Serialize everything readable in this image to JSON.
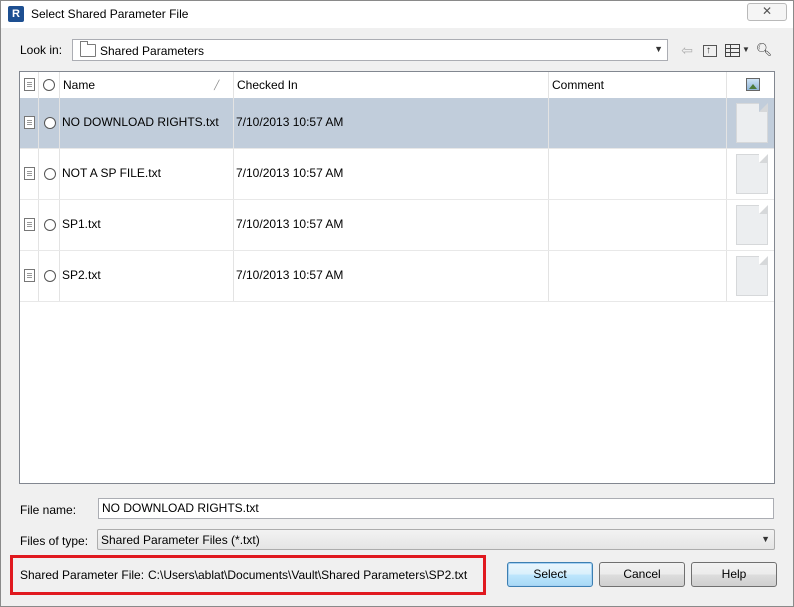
{
  "window": {
    "title": "Select Shared Parameter File",
    "close_glyph": "✕"
  },
  "lookin": {
    "label": "Look in:",
    "value": "Shared Parameters"
  },
  "toolbar": {
    "icons": [
      "back-arrow-icon",
      "up-one-level-icon",
      "views-menu-icon",
      "find-files-icon"
    ]
  },
  "columns": {
    "name": "Name",
    "checked_in": "Checked In",
    "comment": "Comment"
  },
  "files": [
    {
      "name": "NO DOWNLOAD RIGHTS.txt",
      "checked_in": "7/10/2013 10:57 AM",
      "comment": "",
      "selected": true
    },
    {
      "name": "NOT A SP FILE.txt",
      "checked_in": "7/10/2013 10:57 AM",
      "comment": "",
      "selected": false
    },
    {
      "name": "SP1.txt",
      "checked_in": "7/10/2013 10:57 AM",
      "comment": "",
      "selected": false
    },
    {
      "name": "SP2.txt",
      "checked_in": "7/10/2013 10:57 AM",
      "comment": "",
      "selected": false
    }
  ],
  "file_name": {
    "label": "File name:",
    "value": "NO DOWNLOAD RIGHTS.txt"
  },
  "files_of_type": {
    "label": "Files of type:",
    "value": "Shared Parameter Files (*.txt)"
  },
  "shared_parameter_file": {
    "label": "Shared Parameter File:",
    "path": "C:\\Users\\ablat\\Documents\\Vault\\Shared Parameters\\SP2.txt"
  },
  "buttons": {
    "select": "Select",
    "cancel": "Cancel",
    "help": "Help"
  },
  "colors": {
    "selected_row": "#c1cddb",
    "highlight_box": "#e0191f",
    "title_icon": "#1d4f91"
  }
}
